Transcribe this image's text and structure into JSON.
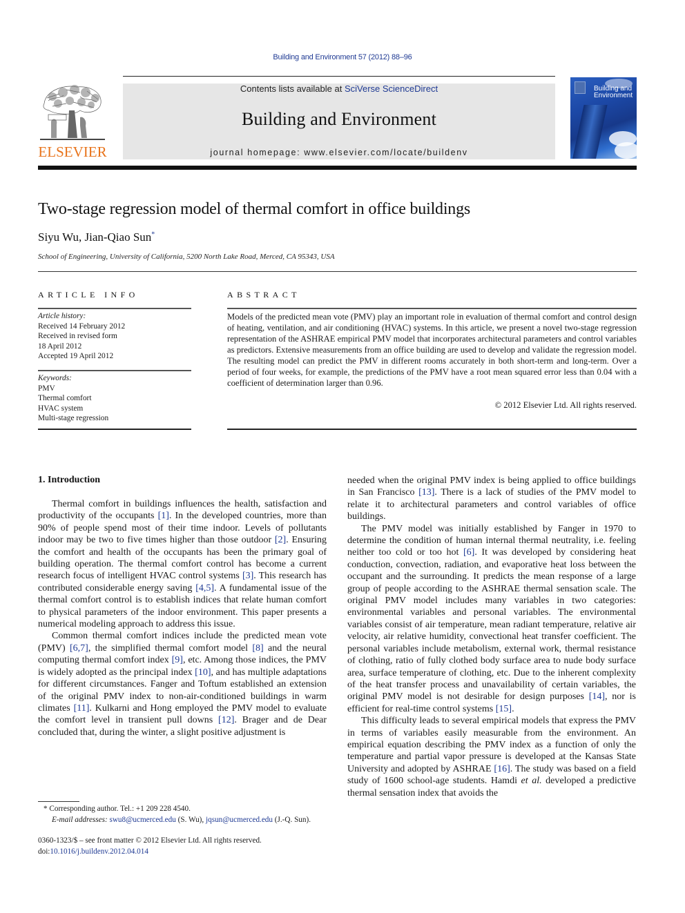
{
  "header": {
    "journal_reference": "Building and Environment 57 (2012) 88–96",
    "contents_prefix": "Contents lists available at ",
    "contents_link": "SciVerse ScienceDirect",
    "journal_title": "Building and Environment",
    "homepage": "journal homepage: www.elsevier.com/locate/buildenv",
    "publisher_logo_text": "ELSEVIER",
    "cover_title_line1": "Building and",
    "cover_title_line2": "Environment",
    "colors": {
      "link": "#1f3a93",
      "elsevier_orange": "#e8731a",
      "masthead_bg": "#e6e6e6"
    }
  },
  "article": {
    "title": "Two-stage regression model of thermal comfort in office buildings",
    "authors": "Siyu Wu, Jian-Qiao Sun",
    "corresponding_mark": "*",
    "affiliation": "School of Engineering, University of California, 5200 North Lake Road, Merced, CA 95343, USA"
  },
  "article_info": {
    "heading": "ARTICLE INFO",
    "history_label": "Article history:",
    "history": [
      "Received 14 February 2012",
      "Received in revised form",
      "18 April 2012",
      "Accepted 19 April 2012"
    ],
    "keywords_label": "Keywords:",
    "keywords": [
      "PMV",
      "Thermal comfort",
      "HVAC system",
      "Multi-stage regression"
    ]
  },
  "abstract": {
    "heading": "ABSTRACT",
    "text": "Models of the predicted mean vote (PMV) play an important role in evaluation of thermal comfort and control design of heating, ventilation, and air conditioning (HVAC) systems. In this article, we present a novel two-stage regression representation of the ASHRAE empirical PMV model that incorporates architectural parameters and control variables as predictors. Extensive measurements from an office building are used to develop and validate the regression model. The resulting model can predict the PMV in different rooms accurately in both short-term and long-term. Over a period of four weeks, for example, the predictions of the PMV have a root mean squared error less than 0.04 with a coefficient of determination larger than 0.96.",
    "copyright": "© 2012 Elsevier Ltd. All rights reserved."
  },
  "body": {
    "section_heading": "1.  Introduction",
    "left_paragraphs": [
      [
        {
          "t": "Thermal comfort in buildings influences the health, satisfaction and productivity of the occupants "
        },
        {
          "c": "[1]"
        },
        {
          "t": ". In the developed countries, more than 90% of people spend most of their time indoor. Levels of pollutants indoor may be two to five times higher than those outdoor "
        },
        {
          "c": "[2]"
        },
        {
          "t": ". Ensuring the comfort and health of the occupants has been the primary goal of building operation. The thermal comfort control has become a current research focus of intelligent HVAC control systems "
        },
        {
          "c": "[3]"
        },
        {
          "t": ". This research has contributed considerable energy saving "
        },
        {
          "c": "[4,5]"
        },
        {
          "t": ". A fundamental issue of the thermal comfort control is to establish indices that relate human comfort to physical parameters of the indoor environment. This paper presents a numerical modeling approach to address this issue."
        }
      ],
      [
        {
          "t": "Common thermal comfort indices include the predicted mean vote (PMV) "
        },
        {
          "c": "[6,7]"
        },
        {
          "t": ", the simplified thermal comfort model "
        },
        {
          "c": "[8]"
        },
        {
          "t": " and the neural computing thermal comfort index "
        },
        {
          "c": "[9]"
        },
        {
          "t": ", etc. Among those indices, the PMV is widely adopted as the principal index "
        },
        {
          "c": "[10]"
        },
        {
          "t": ", and has multiple adaptations for different circumstances. Fanger and Toftum established an extension of the original PMV index to non-air-conditioned buildings in warm climates "
        },
        {
          "c": "[11]"
        },
        {
          "t": ". Kulkarni and Hong employed the PMV model to evaluate the comfort level in transient pull downs "
        },
        {
          "c": "[12]"
        },
        {
          "t": ". Brager and de Dear concluded that, during the winter, a slight positive adjustment is"
        }
      ]
    ],
    "right_paragraphs": [
      [
        {
          "t": "needed when the original PMV index is being applied to office buildings in San Francisco "
        },
        {
          "c": "[13]"
        },
        {
          "t": ". There is a lack of studies of the PMV model to relate it to architectural parameters and control variables of office buildings."
        }
      ],
      [
        {
          "t": "The PMV model was initially established by Fanger in 1970 to determine the condition of human internal thermal neutrality, i.e. feeling neither too cold or too hot "
        },
        {
          "c": "[6]"
        },
        {
          "t": ". It was developed by considering heat conduction, convection, radiation, and evaporative heat loss between the occupant and the surrounding. It predicts the mean response of a large group of people according to the ASHRAE thermal sensation scale. The original PMV model includes many variables in two categories: environmental variables and personal variables. The environmental variables consist of air temperature, mean radiant temperature, relative air velocity, air relative humidity, convectional heat transfer coefficient. The personal variables include metabolism, external work, thermal resistance of clothing, ratio of fully clothed body surface area to nude body surface area, surface temperature of clothing, etc. Due to the inherent complexity of the heat transfer process and unavailability of certain variables, the original PMV model is not desirable for design purposes "
        },
        {
          "c": "[14]"
        },
        {
          "t": ", nor is efficient for real-time control systems "
        },
        {
          "c": "[15]"
        },
        {
          "t": "."
        }
      ],
      [
        {
          "t": "This difficulty leads to several empirical models that express the PMV in terms of variables easily measurable from the environment. An empirical equation describing the PMV index as a function of only the temperature and partial vapor pressure is developed at the Kansas State University and adopted by ASHRAE "
        },
        {
          "c": "[16]"
        },
        {
          "t": ". The study was based on a field study of 1600 school-age students. Hamdi "
        },
        {
          "i": "et al."
        },
        {
          "t": " developed a predictive thermal sensation index that avoids the"
        }
      ]
    ]
  },
  "footnote": {
    "mark": "*",
    "corresponding": "Corresponding author. Tel.: +1 209 228 4540.",
    "email_label": "E-mail addresses:",
    "email1": "swu8@ucmerced.edu",
    "email1_who": " (S. Wu), ",
    "email2": "jqsun@ucmerced.edu",
    "email2_who": " (J.-Q. Sun)."
  },
  "front_matter": {
    "issn_line": "0360-1323/$ – see front matter © 2012 Elsevier Ltd. All rights reserved.",
    "doi_prefix": "doi:",
    "doi": "10.1016/j.buildenv.2012.04.014"
  }
}
